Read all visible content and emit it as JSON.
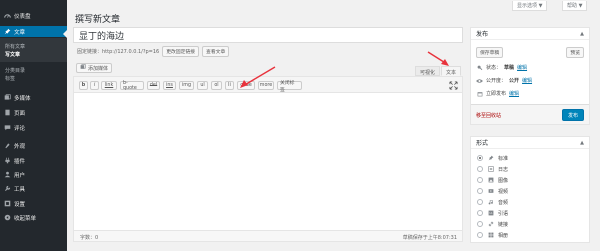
{
  "sidebar": {
    "items": [
      {
        "label": "仪表盘",
        "icon": "dashboard-icon"
      },
      {
        "label": "文章",
        "icon": "pin-icon"
      },
      {
        "label": "多媒体",
        "icon": "media-icon"
      },
      {
        "label": "页面",
        "icon": "page-icon"
      },
      {
        "label": "评论",
        "icon": "comment-icon"
      },
      {
        "label": "外观",
        "icon": "appearance-icon"
      },
      {
        "label": "插件",
        "icon": "plugin-icon"
      },
      {
        "label": "用户",
        "icon": "user-icon"
      },
      {
        "label": "工具",
        "icon": "tools-icon"
      },
      {
        "label": "设置",
        "icon": "settings-icon"
      },
      {
        "label": "收起菜单",
        "icon": "collapse-icon"
      }
    ],
    "submenu": [
      "所有文章",
      "写文章",
      "分类目录",
      "标签"
    ]
  },
  "top": {
    "screen_options": "显示选项 ▼",
    "help": "帮助 ▼"
  },
  "page_title": "撰写新文章",
  "post_title": "显丁的海边",
  "permalink": {
    "label": "固定链接：http://127.0.0.1/?p=16",
    "change_btn": "更改固定链接",
    "view_btn": "查看文章"
  },
  "editor": {
    "add_media": "添加媒体",
    "tab_visual": "可视化",
    "tab_text": "文本",
    "quicktags": [
      "b",
      "i",
      "link",
      "b-quote",
      "del",
      "ins",
      "img",
      "ul",
      "ol",
      "li",
      "code",
      "more",
      "关闭标签"
    ],
    "word_count": "字数：0",
    "draft_saved": "草稿保存于上午8:07:31"
  },
  "publish": {
    "title": "发布",
    "save_draft": "保存草稿",
    "preview": "预览",
    "status_label": "状态：",
    "status_value": "草稿",
    "visibility_label": "公开度：",
    "visibility_value": "公开",
    "schedule_label": "立即发布",
    "edit": "编辑",
    "trash": "移至回收站",
    "publish_btn": "发布"
  },
  "format": {
    "title": "形式",
    "options": [
      {
        "label": "标准",
        "icon": "pin-icon",
        "checked": true
      },
      {
        "label": "日志",
        "icon": "aside-icon",
        "checked": false
      },
      {
        "label": "图像",
        "icon": "image-icon",
        "checked": false
      },
      {
        "label": "视频",
        "icon": "video-icon",
        "checked": false
      },
      {
        "label": "音频",
        "icon": "audio-icon",
        "checked": false
      },
      {
        "label": "引语",
        "icon": "quote-icon",
        "checked": false
      },
      {
        "label": "链接",
        "icon": "link-icon",
        "checked": false
      },
      {
        "label": "相册",
        "icon": "gallery-icon",
        "checked": false
      }
    ]
  },
  "colors": {
    "sidebar_bg": "#23282d",
    "accent": "#0073aa",
    "primary_button": "#0085ba",
    "trash": "#a00000",
    "annotation_arrow": "#e8323c"
  }
}
